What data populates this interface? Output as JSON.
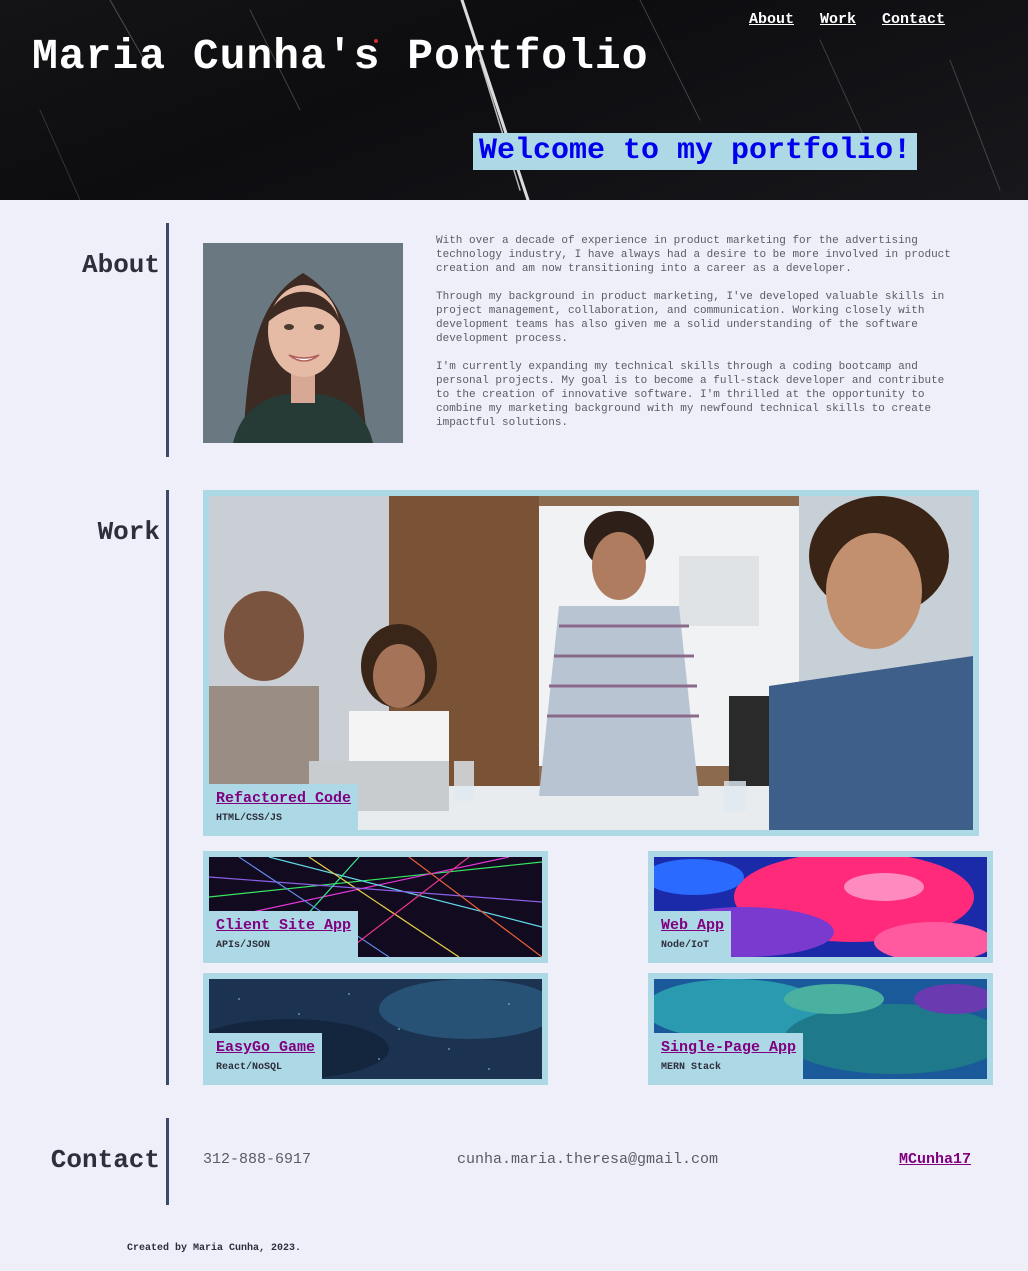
{
  "header": {
    "title": "Maria Cunha's Portfolio",
    "nav": [
      {
        "label": "About"
      },
      {
        "label": "Work"
      },
      {
        "label": "Contact"
      }
    ],
    "welcome": "Welcome to my portfolio!"
  },
  "about": {
    "heading": "About",
    "paragraphs": [
      "With over a decade of experience in product marketing for the advertising technology industry, I have always had a desire to be more involved in product creation and am now transitioning into a career as a developer.",
      "Through my background in product marketing, I've developed valuable skills in project management, collaboration, and communication. Working closely with development teams has also given me a solid understanding of the software development process.",
      "I'm currently expanding my technical skills through a coding bootcamp and personal projects. My goal is to become a full-stack developer and contribute to the creation of innovative software. I'm thrilled at the opportunity to combine my marketing background with my newfound technical skills to create impactful solutions."
    ]
  },
  "work": {
    "heading": "Work",
    "projects": [
      {
        "title": "Refactored Code",
        "tech": "HTML/CSS/JS"
      },
      {
        "title": "Client Site App",
        "tech": "APIs/JSON"
      },
      {
        "title": "Web App",
        "tech": "Node/IoT"
      },
      {
        "title": "EasyGo Game",
        "tech": "React/NoSQL"
      },
      {
        "title": "Single-Page App",
        "tech": "MERN Stack"
      }
    ]
  },
  "contact": {
    "heading": "Contact",
    "phone": "312-888-6917",
    "email": "cunha.maria.theresa@gmail.com",
    "github": "MCunha17"
  },
  "footer": {
    "text": "Created by Maria Cunha, 2023."
  },
  "colors": {
    "accent": "#add8e6",
    "link": "#800080",
    "welcome_text": "#0000ee",
    "background": "#eeeff8",
    "header_bg": "#111114"
  }
}
